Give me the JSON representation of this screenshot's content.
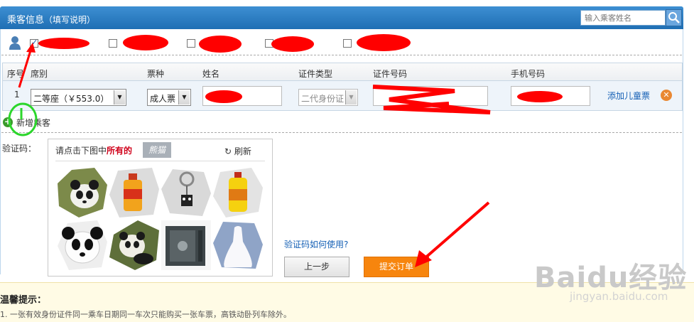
{
  "header": {
    "title": "乘客信息",
    "subtitle": "（填写说明）",
    "search_placeholder": "输入乘客姓名"
  },
  "table": {
    "headers": [
      "序号",
      "席别",
      "票种",
      "姓名",
      "证件类型",
      "证件号码",
      "手机号码"
    ],
    "row": {
      "index": "1",
      "seat": "二等座（￥553.0）",
      "ticket_type": "成人票",
      "id_type": "二代身份证",
      "add_child": "添加儿童票"
    }
  },
  "add_passenger": "新增乘客",
  "captcha": {
    "label": "验证码：",
    "prompt_prefix": "请点击下图中",
    "prompt_highlight": "所有的",
    "word": "熊猫",
    "refresh": "刷新",
    "tiles": [
      "panda",
      "oil-bottle",
      "keychain",
      "oil-bottle",
      "panda",
      "panda",
      "safe",
      "wedding-dress"
    ]
  },
  "help_link": "验证码如何使用?",
  "buttons": {
    "prev": "上一步",
    "submit": "提交订单"
  },
  "tips": {
    "title": "温馨提示：",
    "line1": "1. 一张有效身份证件同一乘车日期同一车次只能购买一张车票，高铁动卧列车除外。"
  },
  "watermark": {
    "brand": "Baidu经验",
    "url": "jingyan.baidu.com"
  },
  "colors": {
    "header": "#2c7cc3",
    "submit": "#f7850d",
    "annotation_red": "#ff0000",
    "annotation_green": "#22cc22"
  }
}
